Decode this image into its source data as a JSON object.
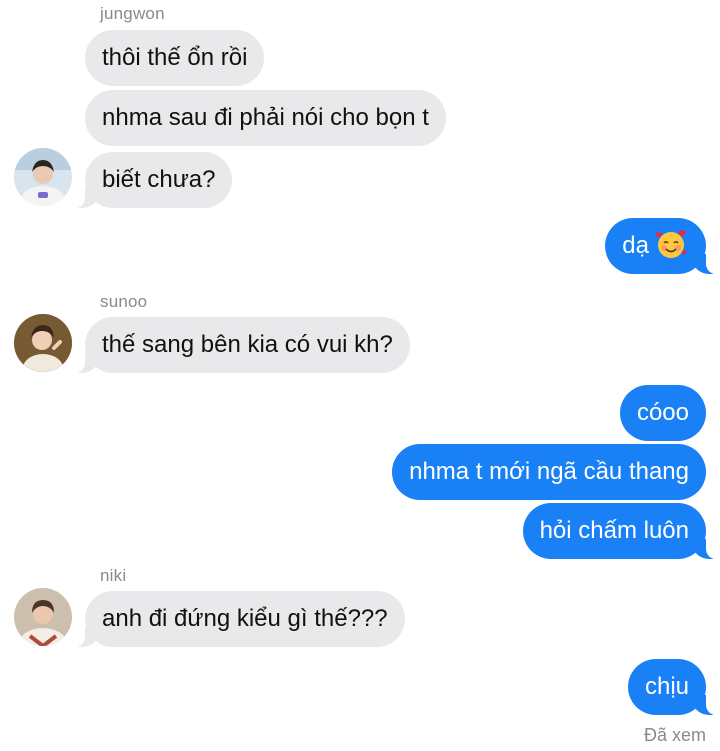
{
  "conversation": {
    "groups": [
      {
        "sender": "jungwon",
        "messages": [
          "thôi thế ổn rồi",
          "nhma sau đi phải nói cho bọn t",
          "biết chưa?"
        ]
      },
      {
        "sender": "sunoo",
        "messages": [
          "thế sang bên kia có vui kh?"
        ]
      },
      {
        "sender": "niki",
        "messages": [
          "anh đi đứng kiểu gì thế???"
        ]
      }
    ],
    "outgoing": [
      {
        "messages": [
          "dạ"
        ],
        "emoji": "smiling-face-with-hearts"
      },
      {
        "messages": [
          "cóoo",
          "nhma t mới ngã cầu thang",
          "hỏi chấm luôn"
        ]
      },
      {
        "messages": [
          "chịu"
        ]
      }
    ],
    "read_receipt": "Đã xem"
  },
  "colors": {
    "outgoing_bubble": "#1a80f6",
    "incoming_bubble": "#e9e9eb",
    "meta_text": "#8a8a8e"
  }
}
